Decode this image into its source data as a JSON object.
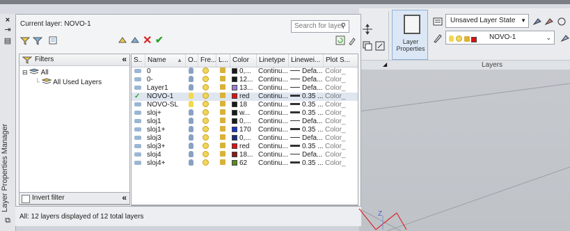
{
  "palette": {
    "vertical_title": "Layer Properties Manager",
    "current_layer": "Current layer: NOVO-1",
    "search_placeholder": "Search for layer",
    "filters_header": "Filters",
    "tree": [
      "All",
      "All Used Layers"
    ],
    "invert_filter": "Invert filter",
    "status": "All: 12 layers displayed of 12 total layers",
    "columns": [
      "S..",
      "Name",
      "O..",
      "Fre...",
      "L...",
      "Color",
      "Linetype",
      "Linewei...",
      "Plot S..."
    ],
    "rows": [
      {
        "name": "0",
        "color_label": "0,...",
        "color": "#1a1a1a",
        "linetype": "Continu...",
        "lineweight": "Defa...",
        "plot": "Color_",
        "thick": false,
        "current": false,
        "on": false
      },
      {
        "name": "0-",
        "color_label": "12...",
        "color": "#1a1a1a",
        "linetype": "Continu...",
        "lineweight": "Defa...",
        "plot": "Color_",
        "thick": false,
        "current": false,
        "on": false
      },
      {
        "name": "Layer1",
        "color_label": "13...",
        "color": "#9b7fd4",
        "linetype": "Continu...",
        "lineweight": "Defa...",
        "plot": "Color_",
        "thick": false,
        "current": false,
        "on": false
      },
      {
        "name": "NOVO-1",
        "color_label": "red",
        "color": "#e01010",
        "linetype": "Continu...",
        "lineweight": "0.35 ...",
        "plot": "Color_",
        "thick": true,
        "current": true,
        "on": true
      },
      {
        "name": "NOVO-SL",
        "color_label": "18",
        "color": "#1a1a1a",
        "linetype": "Continu...",
        "lineweight": "0.35 ...",
        "plot": "Color_",
        "thick": true,
        "current": false,
        "on": true
      },
      {
        "name": "sloj+",
        "color_label": "w...",
        "color": "#1a1a1a",
        "linetype": "Continu...",
        "lineweight": "0.35 ...",
        "plot": "Color_",
        "thick": true,
        "current": false,
        "on": false
      },
      {
        "name": "sloj1",
        "color_label": "0,...",
        "color": "#1a1a1a",
        "linetype": "Continu...",
        "lineweight": "Defa...",
        "plot": "Color_",
        "thick": false,
        "current": false,
        "on": false
      },
      {
        "name": "sloj1+",
        "color_label": "170",
        "color": "#1c34c8",
        "linetype": "Continu...",
        "lineweight": "0.35 ...",
        "plot": "Color_",
        "thick": true,
        "current": false,
        "on": false
      },
      {
        "name": "sloj3",
        "color_label": "0,...",
        "color": "#1c2c7a",
        "linetype": "Continu...",
        "lineweight": "Defa...",
        "plot": "Color_",
        "thick": false,
        "current": false,
        "on": false
      },
      {
        "name": "sloj3+",
        "color_label": "red",
        "color": "#e01010",
        "linetype": "Continu...",
        "lineweight": "0.35 ...",
        "plot": "Color_",
        "thick": true,
        "current": false,
        "on": false
      },
      {
        "name": "sloj4",
        "color_label": "18...",
        "color": "#8b1a1a",
        "linetype": "Continu...",
        "lineweight": "Defa...",
        "plot": "Color_",
        "thick": false,
        "current": false,
        "on": false
      },
      {
        "name": "sloj4+",
        "color_label": "62",
        "color": "#5c8a1e",
        "linetype": "Continu...",
        "lineweight": "0.35 ...",
        "plot": "Color_",
        "thick": true,
        "current": false,
        "on": false
      }
    ]
  },
  "ribbon": {
    "layer_properties_label": "Layer Properties",
    "layer_state": "Unsaved Layer State",
    "current_layer_combo": "NOVO-1",
    "group_label": "Layers"
  },
  "canvas": {
    "axis_label": "Z"
  }
}
